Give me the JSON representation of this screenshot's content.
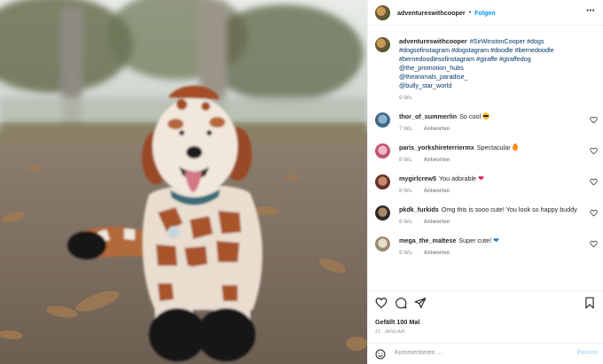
{
  "post": {
    "author": "adventureswithcooper",
    "follow_label": "Folgen",
    "caption_tags": "#SirWinstonCooper #dogs #dogsofinstagram #dogstagram #doodle #bernedoodle #bernedoodlesofinstagram #giraffe #giraffedog",
    "caption_mentions": [
      "@the_promotion_hubs",
      "@theanimals_paradise_",
      "@bully_star_world"
    ],
    "caption_age": "9 Wo."
  },
  "comments": [
    {
      "user": "thor_of_summerlin",
      "text": "So cool",
      "emoji": "sunglasses-emoji",
      "age": "7 Wo.",
      "reply": "Antworten"
    },
    {
      "user": "paris_yorkshireterriermx",
      "text": "Spectacular",
      "emoji": "fire-emoji",
      "age": "8 Wo.",
      "reply": "Antworten"
    },
    {
      "user": "mygirlcrew5",
      "text": "You adorable",
      "emoji": "red-heart-emoji",
      "age": "8 Wo.",
      "reply": "Antworten"
    },
    {
      "user": "pkdk_furkids",
      "text": "Omg this is sooo cute! You look so happy buddy",
      "emoji": "",
      "age": "8 Wo.",
      "reply": "Antworten"
    },
    {
      "user": "mega_the_maltese",
      "text": "Super cute!",
      "emoji": "blue-heart-emoji",
      "age": "9 Wo.",
      "reply": "Antworten"
    }
  ],
  "stats": {
    "likes": "Gefällt 100 Mal",
    "date": "21. JANUAR"
  },
  "comment_input": {
    "placeholder": "Kommentieren ...",
    "post_label": "Posten"
  },
  "colors": {
    "link_blue": "#0095f6",
    "tag_blue": "#00376b",
    "muted": "#8e8e8e"
  },
  "icons": [
    "more-options-icon",
    "like-heart-icon",
    "comment-icon",
    "share-icon",
    "bookmark-icon",
    "emoji-icon"
  ]
}
